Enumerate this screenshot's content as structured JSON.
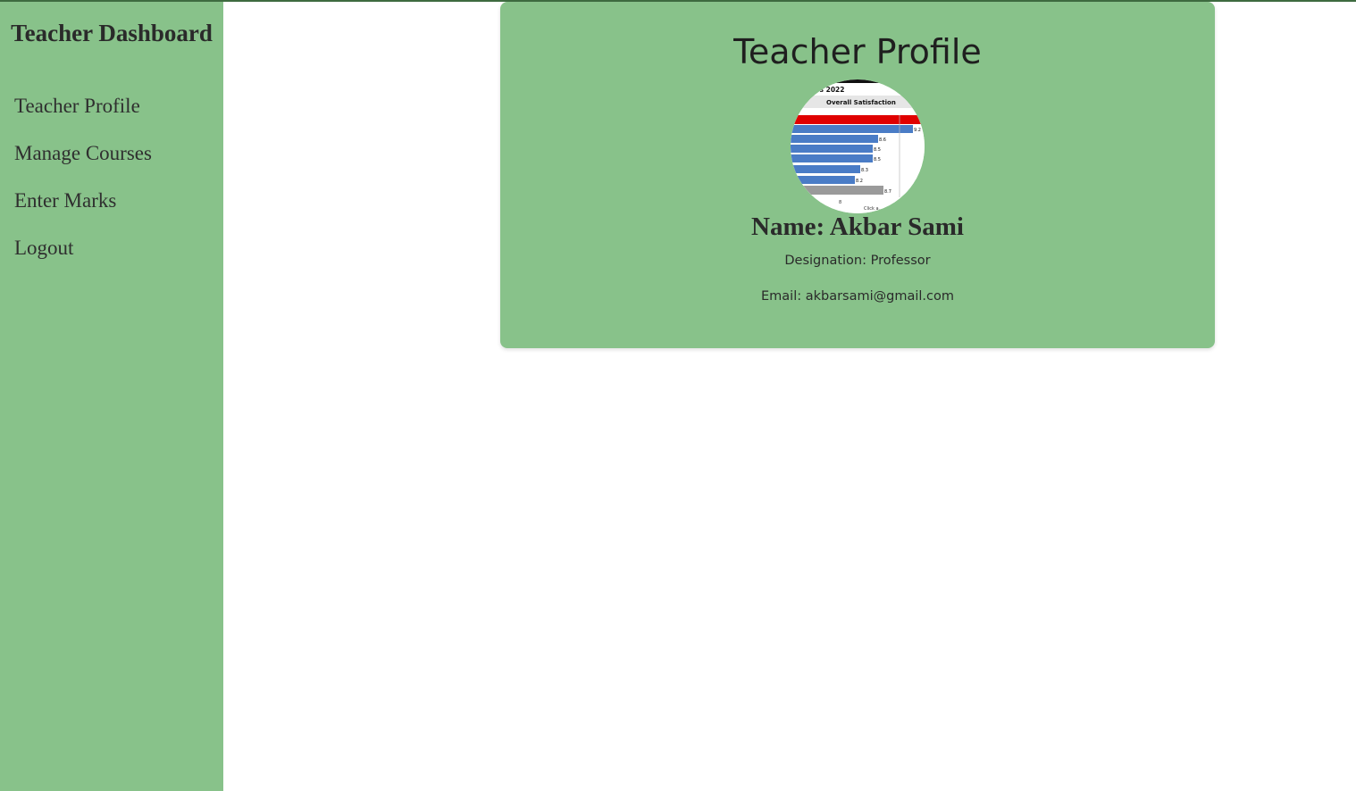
{
  "sidebar": {
    "title": "Teacher Dashboard",
    "items": [
      {
        "label": "Teacher Profile"
      },
      {
        "label": "Manage Courses"
      },
      {
        "label": "Enter Marks"
      },
      {
        "label": "Logout"
      }
    ]
  },
  "profile": {
    "heading": "Teacher Profile",
    "name": "Name: Akbar Sami",
    "designation": "Designation: Professor",
    "email": "Email: akbarsami@gmail.com",
    "photo": {
      "title_fragment": "ops  2022",
      "subtitle": "Overall Satisfaction",
      "bar_labels": [
        "9.2",
        "8.6",
        "8.5",
        "8.5",
        "8.3",
        "8.2",
        "8.7"
      ],
      "axis_tick": "8",
      "footer_fragment": "Click a..."
    }
  },
  "colors": {
    "sidebar_bg": "#88c28a",
    "card_bg": "#88c28a",
    "top_border": "#3e6b40"
  }
}
